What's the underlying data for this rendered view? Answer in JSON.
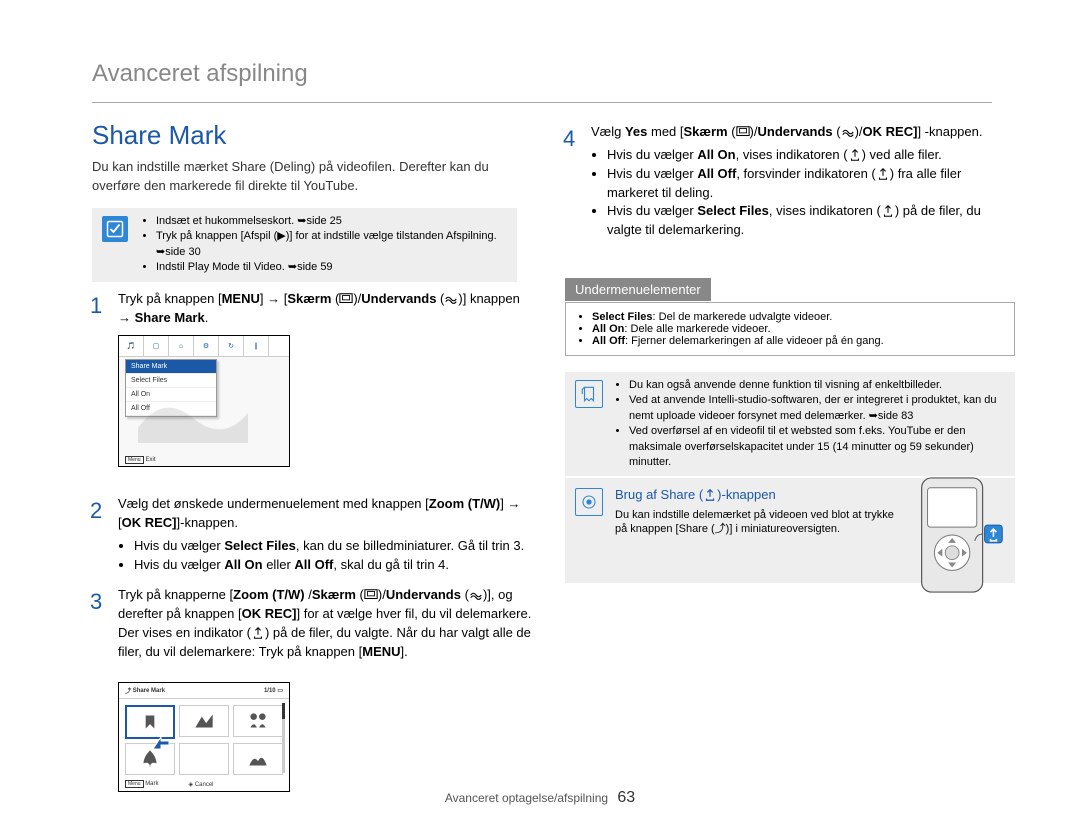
{
  "header": {
    "breadcrumb": "Avanceret afspilning"
  },
  "title": "Share Mark",
  "intro": "Du kan indstille mærket Share (Deling) på videofilen. Derefter kan du overføre den markerede fil direkte til YouTube.",
  "callout_left": [
    "Indsæt et hukommelseskort. ➥side 25",
    "Tryk på knappen [Afspil (▶)] for at indstille vælge tilstanden Afspilning. ➥side 30",
    "Indstil Play Mode til Video. ➥side 59"
  ],
  "shot1": {
    "tabs": [
      "🎵",
      "▢",
      "⌂",
      "⚙",
      "↻",
      "∥"
    ],
    "selected": "Share Mark",
    "rows": [
      "Select Files",
      "All On",
      "All Off"
    ],
    "exit_btn": "Menu",
    "exit_label": "Exit"
  },
  "step1_num": "1",
  "step1_a": "Tryk på knappen [",
  "step1_b": "MENU",
  "step1_c": "] → [",
  "step1_d": "Skærm",
  "step1_e": " (",
  "step1_f": ")/",
  "step1_g": "Undervands",
  "step1_h": " (",
  "step1_i": ")] knappen → ",
  "step1_j": "Share Mark",
  "step1_k": ".",
  "step2_num": "2",
  "step2_a": "Vælg det ønskede undermenuelement med knappen\n[",
  "step2_b": "Zoom (T/W)",
  "step2_c": "] → [",
  "step2_d": "OK REC]",
  "step2_e": "]-knappen.",
  "step2_bul1a": "Hvis du vælger ",
  "step2_bul1b": "Select Files",
  "step2_bul1c": ", kan du se billedminiaturer. Gå til trin 3.",
  "step2_bul2a": "Hvis du vælger ",
  "step2_bul2b": "All On",
  "step2_bul2c": " eller ",
  "step2_bul2d": "All Off",
  "step2_bul2e": ", skal du gå til trin 4.",
  "step3_num": "3",
  "step3_a": "Tryk på knapperne [",
  "step3_b": "Zoom (T/W)",
  "step3_c": " /",
  "step3_d": "Skærm",
  "step3_e": " (",
  "step3_f": ")/",
  "step3_g": "Undervands",
  "step3_h": " (",
  "step3_i": ")], og derefter på knappen [",
  "step3_j": "OK REC]",
  "step3_k": "] for at vælge hver fil, du vil delemarkere. Der vises en indikator (",
  "step3_l": ") på de filer, du valgte. Når du har valgt alle de filer, du vil delemarkere: Tryk på knappen [",
  "step3_m": "MENU",
  "step3_n": "].",
  "shot2": {
    "header_icon": "⤴",
    "header_text": "Share Mark",
    "counter": "1/10",
    "mark_btn": "Menu",
    "mark_label": "Mark",
    "cancel_icon": "◈",
    "cancel_label": "Cancel"
  },
  "step4_num": "4",
  "step4_a": "Vælg ",
  "step4_b": "Yes",
  "step4_c": " med [",
  "step4_d": "Skærm",
  "step4_e": " (",
  "step4_f": ")/",
  "step4_g": "Undervands",
  "step4_h": " (",
  "step4_i": ")/",
  "step4_j": "OK REC]",
  "step4_k": "] -knappen.",
  "r_bul1a": "Hvis du vælger ",
  "r_bul1b": "All On",
  "r_bul1c": ", vises indikatoren (",
  "r_bul1d": ") ved alle filer.",
  "r_bul2a": "Hvis du vælger ",
  "r_bul2b": "All Off",
  "r_bul2c": ", forsvinder indikatoren (",
  "r_bul2d": ") fra alle filer markeret til deling.",
  "r_bul3a": "Hvis du vælger ",
  "r_bul3b": "Select Files",
  "r_bul3c": ", vises indikatoren (",
  "r_bul3d": ") på de filer, du valgte til delemarkering.",
  "sub_title": "Undermenuelementer",
  "sub_items": [
    {
      "b": "Select Files",
      "t": ": Del de markerede udvalgte videoer."
    },
    {
      "b": "All On",
      "t": ": Dele alle markerede videoer."
    },
    {
      "b": "All Off",
      "t": ": Fjerner delemarkeringen af alle videoer på én gang."
    }
  ],
  "callout_right": [
    "Du kan også anvende denne funktion til visning af enkeltbilleder.",
    "Ved at anvende Intelli-studio-softwaren, der er integreret i produktet, kan du nemt uploade videoer forsynet med delemærker. ➥side 83",
    "Ved overførsel af en videofil til et websted som f.eks. YouTube er den maksimale overførselskapacitet under 15 (14 minutter og 59 sekunder) minutter."
  ],
  "share_tip": {
    "title_a": "Brug af Share (",
    "title_b": ")-knappen",
    "body": "Du kan indstille delemærket på videoen ved blot at trykke på knappen [Share (⤴)] i miniatureoversigten."
  },
  "footer": {
    "section": "Avanceret optagelse/afspilning",
    "page": "63"
  }
}
